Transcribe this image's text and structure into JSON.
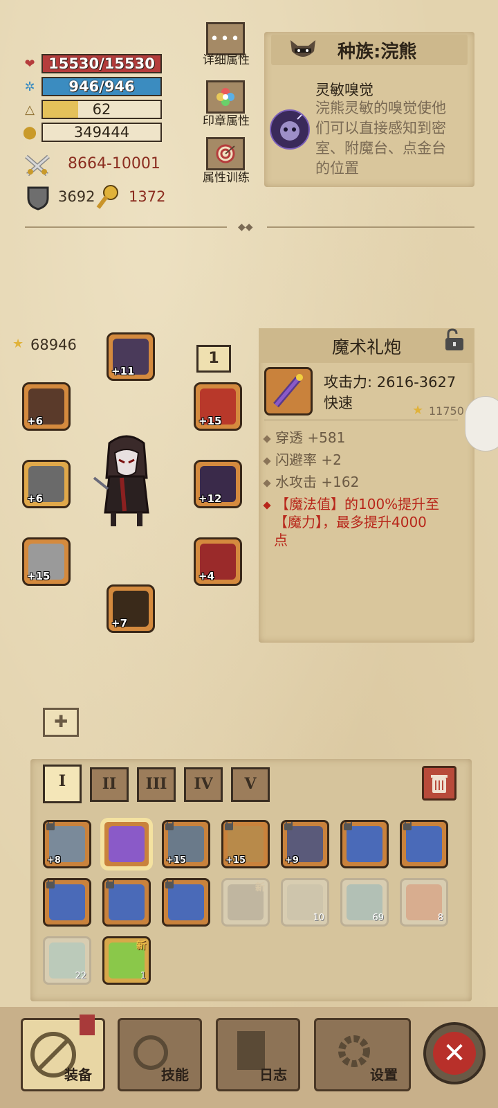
{
  "stats": {
    "hp": "15530/15530",
    "hp_fraction": 1.0,
    "mp": "946/946",
    "mp_fraction": 1.0,
    "level": "62",
    "level_fraction": 0.3,
    "gold": "349444",
    "attack": "8664-10001",
    "defense": "3692",
    "magic": "1372"
  },
  "side_buttons": {
    "detail": "详细属性",
    "seal": "印章属性",
    "training": "属性训练"
  },
  "race": {
    "title": "种族:浣熊",
    "skill_name": "灵敏嗅觉",
    "skill_desc": "浣熊灵敏的嗅觉使他们可以直接感知到密室、附魔台、点金台的位置"
  },
  "equipment": {
    "score": "68946",
    "slot_number": "1",
    "slots": [
      {
        "id": "helmet",
        "plus": "+11"
      },
      {
        "id": "amulet",
        "plus": "+6"
      },
      {
        "id": "offhand",
        "plus": "+6"
      },
      {
        "id": "weapon",
        "plus": "+15"
      },
      {
        "id": "mainhand",
        "plus": "+15"
      },
      {
        "id": "armor",
        "plus": "+12"
      },
      {
        "id": "gloves",
        "plus": "+4"
      },
      {
        "id": "boots",
        "plus": "+7"
      }
    ]
  },
  "item_detail": {
    "name": "魔术礼炮",
    "attack": "攻击力: 2616-3627",
    "speed": "快速",
    "score": "11750",
    "attrs": [
      "穿透 +581",
      "闪避率 +2",
      "水攻击 +162"
    ],
    "special_line1": "【魔法值】的100%提升至",
    "special_line2": "【魔力】，最多提升4000",
    "special_line3": "点"
  },
  "tabs": [
    "I",
    "II",
    "III",
    "IV",
    "V"
  ],
  "inventory": [
    {
      "plus": "+8",
      "locked": true
    },
    {
      "plus": "",
      "locked": false
    },
    {
      "plus": "+15",
      "locked": true
    },
    {
      "plus": "+15",
      "locked": true
    },
    {
      "plus": "+9",
      "locked": true
    },
    {
      "plus": "",
      "locked": true
    },
    {
      "plus": "",
      "locked": true
    },
    {
      "plus": "",
      "locked": true
    },
    {
      "plus": "",
      "locked": true
    },
    {
      "plus": "",
      "locked": true
    },
    {
      "count": "",
      "new": "新"
    },
    {
      "count": "10"
    },
    {
      "count": "69"
    },
    {
      "count": "8"
    },
    {
      "count": "22"
    },
    {
      "count": "1",
      "new": "新"
    }
  ],
  "nav": {
    "equip": "装备",
    "skill": "技能",
    "log": "日志",
    "settings": "设置"
  },
  "colors": {
    "hp": "#b53c3c",
    "mp": "#3b8cc0",
    "xp": "#e4c15a",
    "attack_text": "#8b2d20",
    "special_text": "#b8261a"
  }
}
